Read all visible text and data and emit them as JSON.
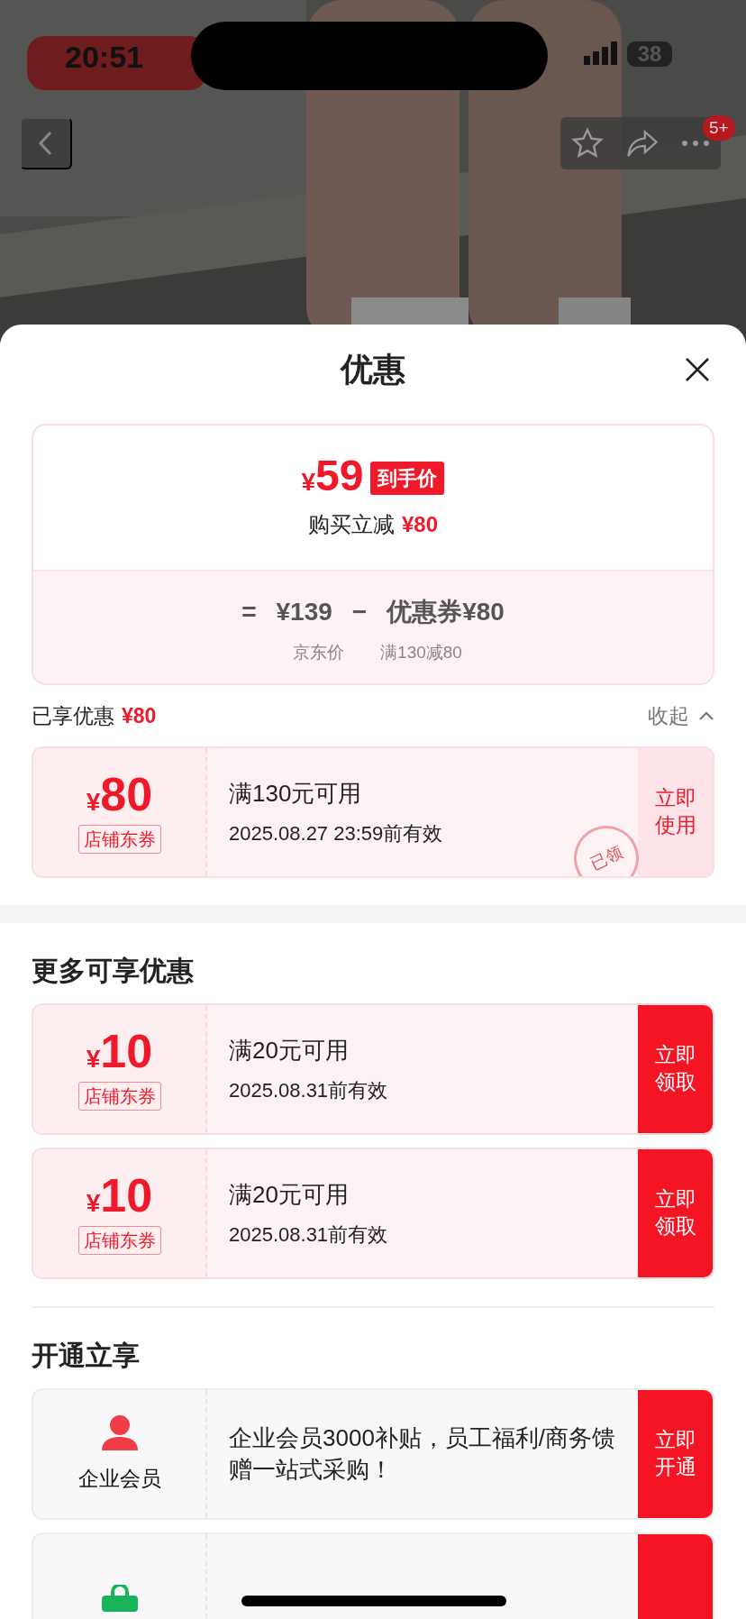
{
  "status_bar": {
    "time": "20:51",
    "battery": "38"
  },
  "nav": {
    "badge": "5+"
  },
  "sheet": {
    "title": "优惠",
    "summary": {
      "currency": "¥",
      "price": "59",
      "price_tag": "到手价",
      "reduce_label": "购买立减",
      "reduce_value": "¥80",
      "equals": "=",
      "original_price": "¥139",
      "minus": "−",
      "coupon_label": "优惠券",
      "coupon_value": "¥80",
      "original_caption": "京东价",
      "coupon_caption": "满130减80"
    },
    "applied": {
      "label": "已享优惠",
      "value": "¥80",
      "toggle": "收起",
      "expanded": true
    },
    "applied_coupons": [
      {
        "currency": "¥",
        "amount": "80",
        "tag": "店铺东券",
        "condition": "满130元可用",
        "validity": "2025.08.27 23:59前有效",
        "action": "立即使用",
        "claimed": true,
        "stamp": "已领"
      }
    ],
    "more_title": "更多可享优惠",
    "more_coupons": [
      {
        "currency": "¥",
        "amount": "10",
        "tag": "店铺东券",
        "condition": "满20元可用",
        "validity": "2025.08.31前有效",
        "action": "立即领取",
        "claimed": false
      },
      {
        "currency": "¥",
        "amount": "10",
        "tag": "店铺东券",
        "condition": "满20元可用",
        "validity": "2025.08.31前有效",
        "action": "立即领取",
        "claimed": false
      }
    ],
    "open_title": "开通立享",
    "memberships": [
      {
        "kind": "person",
        "name": "企业会员",
        "description": "企业会员3000补贴，员工福利/商务馈赠一站式采购！",
        "action": "立即开通"
      },
      {
        "kind": "bag"
      }
    ]
  }
}
